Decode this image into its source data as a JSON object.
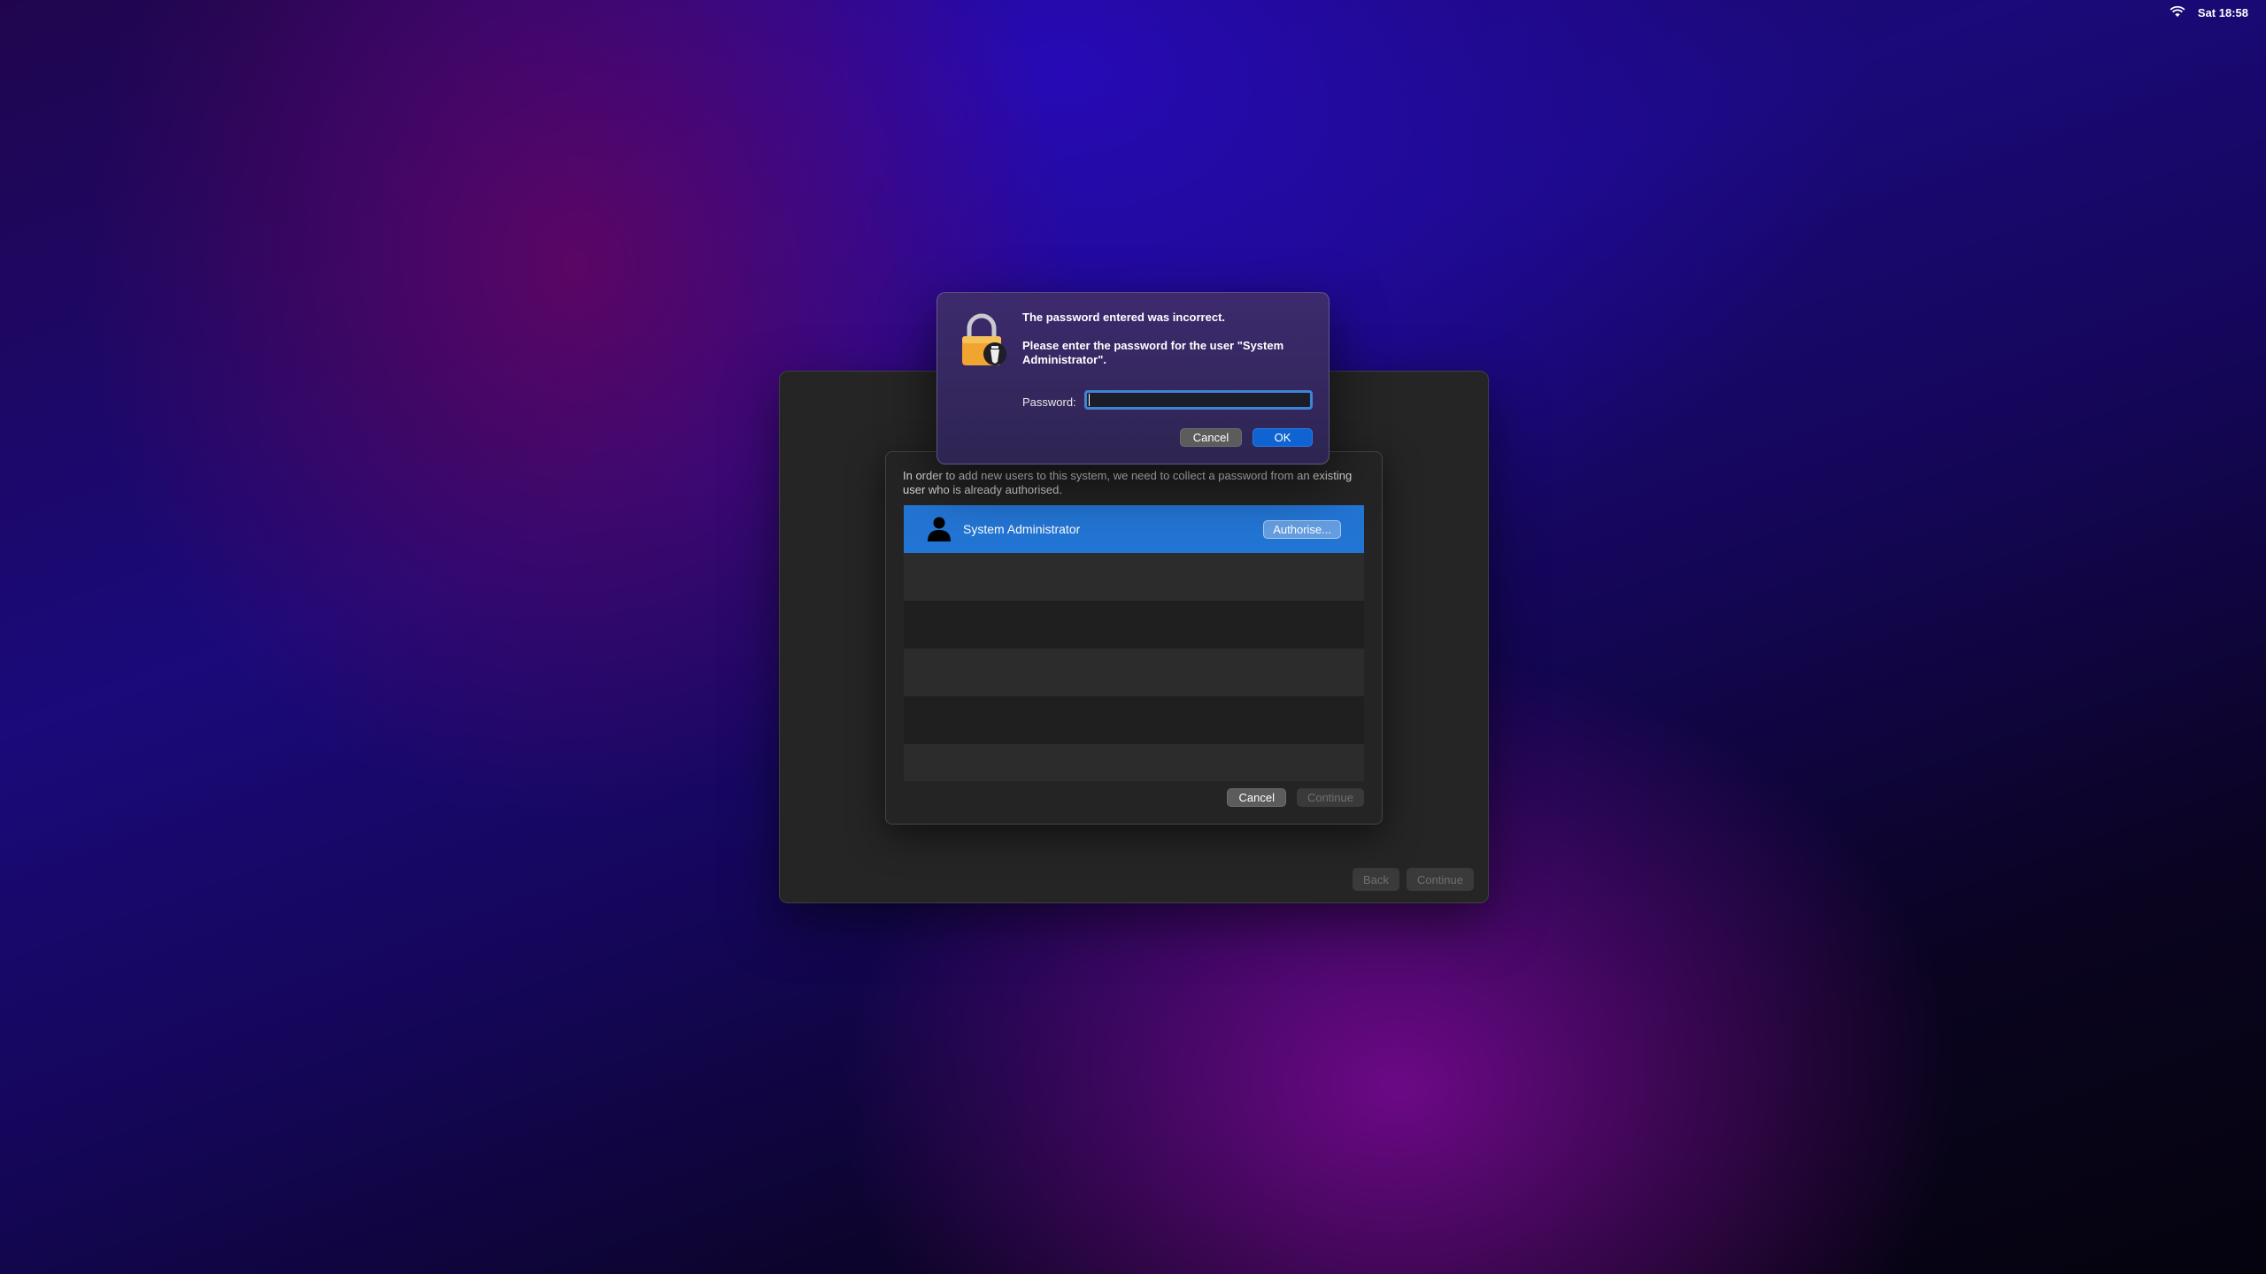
{
  "menubar": {
    "wifi_icon": "wifi-icon",
    "clock": "Sat 18:58"
  },
  "main_window": {
    "back_label": "Back",
    "continue_label": "Continue"
  },
  "sheet": {
    "message": "In order to add new users to this system, we need to collect a password from an existing user who is already authorised.",
    "users": [
      {
        "name": "System Administrator",
        "icon": "person-icon",
        "action_label": "Authorise..."
      }
    ],
    "cancel_label": "Cancel",
    "continue_label": "Continue"
  },
  "password_dialog": {
    "title": "The password entered was incorrect.",
    "message": "Please enter the password for the user \"System Administrator\".",
    "password_label": "Password:",
    "password_value": "",
    "cancel_label": "Cancel",
    "ok_label": "OK",
    "icon": "lock-icon"
  },
  "colors": {
    "accent": "#0f64d2",
    "selection": "#2375d4"
  }
}
